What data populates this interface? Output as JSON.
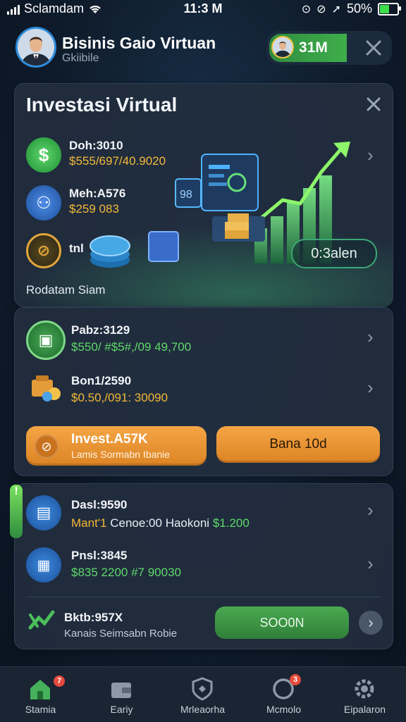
{
  "status_bar": {
    "carrier": "Sclamdam",
    "time": "11:3 M",
    "battery": "50%",
    "battery_level": 0.5
  },
  "header": {
    "title": "Bisinis Gaio Virtuan",
    "subtitle": "Gkiibile",
    "balance": "31M"
  },
  "investment_card": {
    "title": "Investasi Virtual",
    "items": [
      {
        "label": "Doh:3010",
        "value": "$555/697/40.9020"
      },
      {
        "label": "Meh:A576",
        "value": "$259 083"
      },
      {
        "label": "tnl",
        "value": ""
      }
    ],
    "footer": "Rodatam Siam",
    "chart_button": "0:3alen"
  },
  "offers_card": {
    "items": [
      {
        "label": "Pabz:3129",
        "value": "$550/ #$5#,/09 49,700"
      },
      {
        "label": "Bon1/2590",
        "value": "$0.50,/091: 30090"
      }
    ],
    "invest_button": {
      "title": "Invest.A57K",
      "subtitle": "Lamis Sormabn Ibanie"
    },
    "secondary_button": "Bana 10d"
  },
  "assets_card": {
    "items": [
      {
        "label": "Dasl:9590",
        "value_part1": "Mant'1",
        "value_part2": "Cenoe:00",
        "value_part3": "Haokoni",
        "value_part4": "$1.200"
      },
      {
        "label": "Pnsl:3845",
        "value": "$835 2200 #7 90030"
      },
      {
        "label": "Bktb:957X",
        "sub": "Kanais Seimsabn Robie"
      }
    ],
    "action_button": "SOO0N"
  },
  "bottom_nav": [
    {
      "label": "Stamia",
      "badge": "7"
    },
    {
      "label": "Eariy"
    },
    {
      "label": "Mrleaorha"
    },
    {
      "label": "Mcmolo",
      "badge": "3"
    },
    {
      "label": "Eipalaron"
    }
  ]
}
